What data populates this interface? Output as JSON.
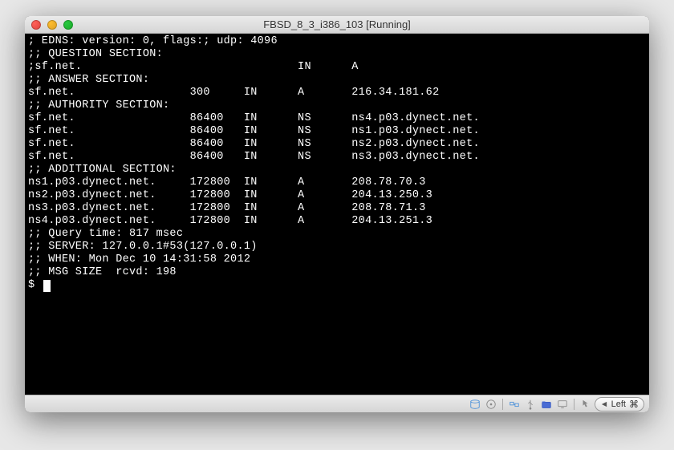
{
  "title": "FBSD_8_3_i386_103 [Running]",
  "terminal": {
    "lines": [
      "; EDNS: version: 0, flags:; udp: 4096",
      ";; QUESTION SECTION:",
      ";sf.net.                                IN      A",
      "",
      ";; ANSWER SECTION:",
      "sf.net.                 300     IN      A       216.34.181.62",
      "",
      ";; AUTHORITY SECTION:",
      "sf.net.                 86400   IN      NS      ns4.p03.dynect.net.",
      "sf.net.                 86400   IN      NS      ns1.p03.dynect.net.",
      "sf.net.                 86400   IN      NS      ns2.p03.dynect.net.",
      "sf.net.                 86400   IN      NS      ns3.p03.dynect.net.",
      "",
      ";; ADDITIONAL SECTION:",
      "ns1.p03.dynect.net.     172800  IN      A       208.78.70.3",
      "ns2.p03.dynect.net.     172800  IN      A       204.13.250.3",
      "ns3.p03.dynect.net.     172800  IN      A       208.78.71.3",
      "ns4.p03.dynect.net.     172800  IN      A       204.13.251.3",
      "",
      ";; Query time: 817 msec",
      ";; SERVER: 127.0.0.1#53(127.0.0.1)",
      ";; WHEN: Mon Dec 10 14:31:58 2012",
      ";; MSG SIZE  rcvd: 198",
      ""
    ],
    "prompt": "$ "
  },
  "statusbar": {
    "left_button": "Left",
    "cmd_symbol": "⌘"
  }
}
